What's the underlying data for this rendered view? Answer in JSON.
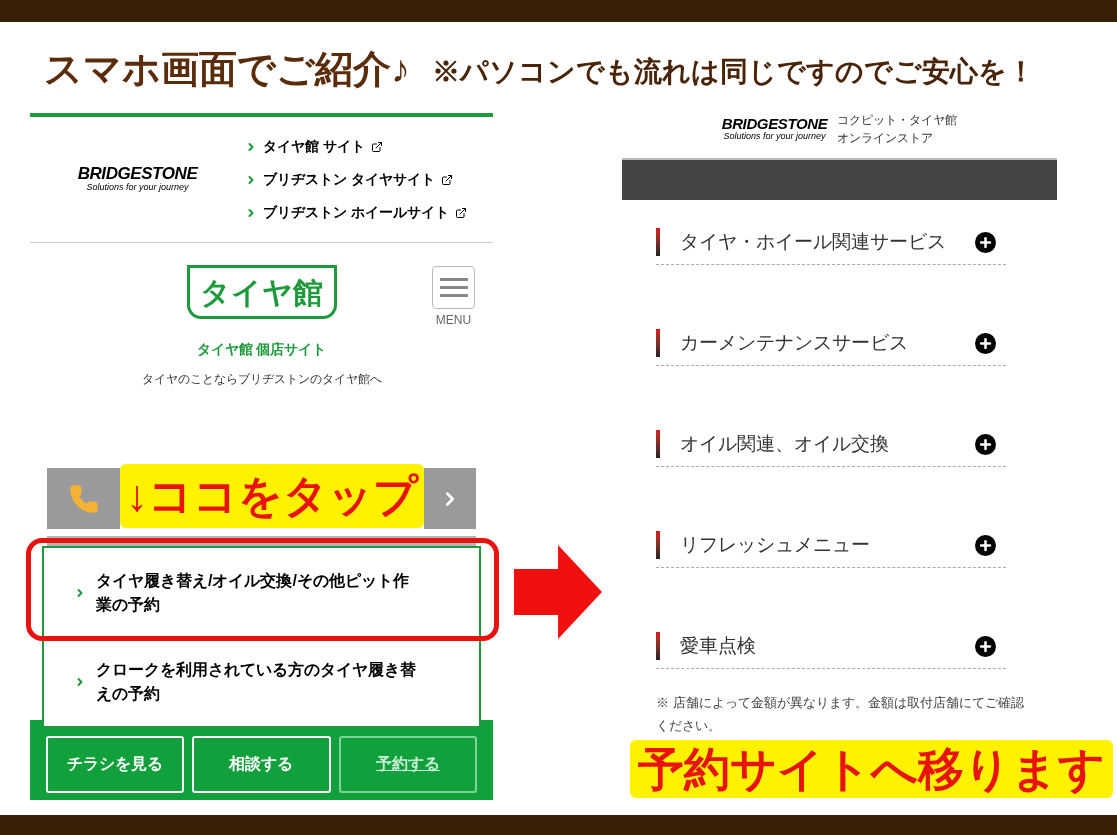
{
  "heading": {
    "title": "スマホ画面でご紹介♪",
    "note": "※パソコンでも流れは同じですのでご安心を！"
  },
  "left_screen": {
    "logo": {
      "brand": "BRIDGESTONE",
      "tagline": "Solutions for your journey"
    },
    "links": [
      "タイヤ館 サイト",
      "ブリヂストン タイヤサイト",
      "ブリヂストン ホイールサイト"
    ],
    "site_logo": "タイヤ館",
    "menu_label": "MENU",
    "site_name": "タイヤ館 個店サイト",
    "site_tagline": "タイヤのことならブリヂストンのタイヤ館へ",
    "callout": "↓ココをタップ",
    "options": [
      {
        "label": "タイヤ履き替え/オイル交換/その他ピット作業の予約",
        "highlighted": true
      },
      {
        "label": "クロークを利用されている方のタイヤ履き替えの予約",
        "highlighted": false
      }
    ],
    "buttons": [
      {
        "label": "チラシを見る",
        "selected": false
      },
      {
        "label": "相談する",
        "selected": false
      },
      {
        "label": "予約する",
        "selected": true
      }
    ]
  },
  "right_screen": {
    "logo": {
      "brand": "BRIDGESTONE",
      "tagline": "Solutions for your journey"
    },
    "store_name": [
      "コクピット・タイヤ館",
      "オンラインストア"
    ],
    "categories": [
      "タイヤ・ホイール関連サービス",
      "カーメンテナンスサービス",
      "オイル関連、オイル交換",
      "リフレッシュメニュー",
      "愛車点検"
    ],
    "notes": [
      "※ 店舗によって金額が異なります。金額は取付店舗にてご確認ください。"
    ],
    "callout": "予約サイトへ移ります"
  }
}
